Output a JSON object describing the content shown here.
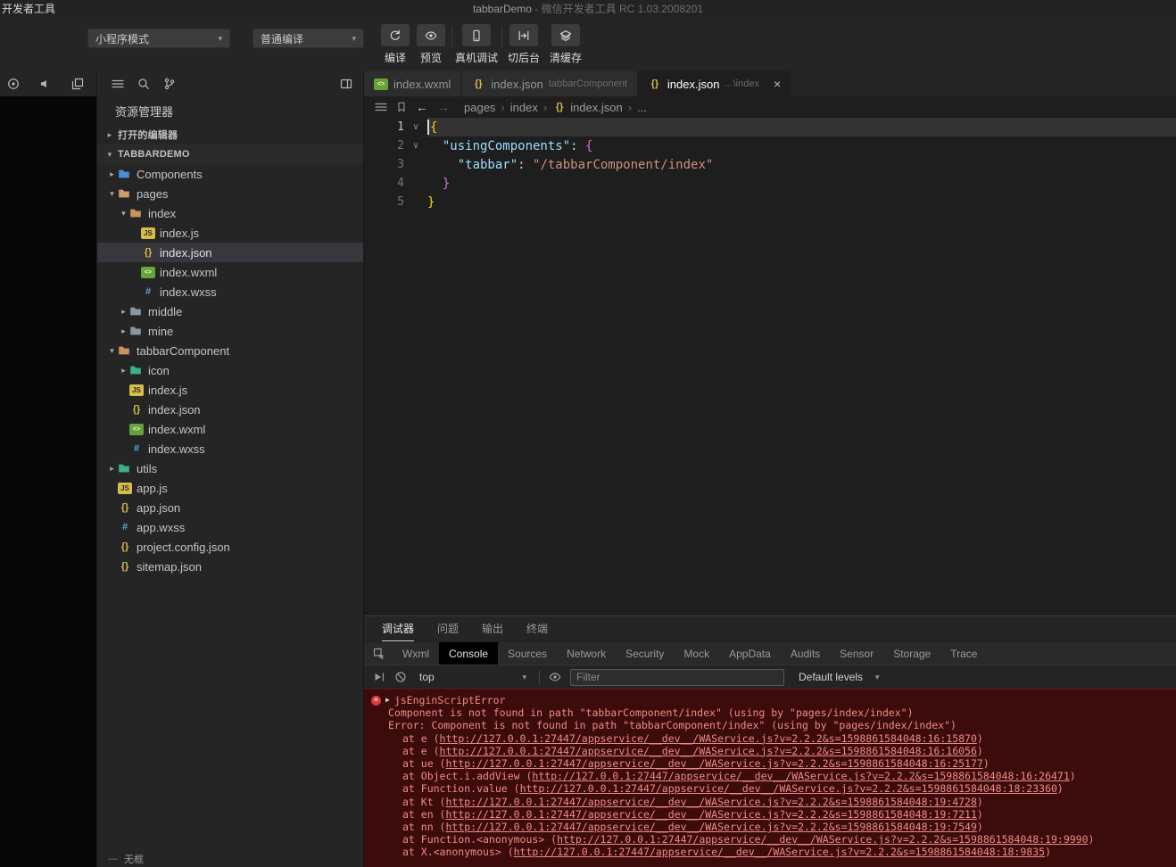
{
  "titlebar": {
    "window_title_left": "开发者工具",
    "project": "tabbarDemo",
    "suffix": " -  微信开发者工具 RC 1.03.2008201"
  },
  "toolbar": {
    "mode_select": "小程序模式",
    "compile_select": "普通编译",
    "actions": [
      {
        "key": "compile",
        "label": "编译",
        "icon": "compile-refresh-icon"
      },
      {
        "key": "preview",
        "label": "预览",
        "icon": "preview-eye-icon"
      },
      {
        "key": "device-debug",
        "label": "真机调试",
        "icon": "device-debug-icon"
      },
      {
        "key": "background",
        "label": "切后台",
        "icon": "background-switch-icon"
      },
      {
        "key": "clear-cache",
        "label": "清缓存",
        "icon": "clear-cache-icon"
      }
    ]
  },
  "explorer": {
    "header": "资源管理器",
    "open_editors_label": "打开的编辑器",
    "project_label": "TABBARDEMO",
    "status": "无框",
    "tree": [
      {
        "label": "Components",
        "depth": 1,
        "icon": "folder",
        "color": "#4a8fd4",
        "arrow": "collapsed"
      },
      {
        "label": "pages",
        "depth": 1,
        "icon": "folder",
        "color": "#d19a66",
        "arrow": "expanded"
      },
      {
        "label": "index",
        "depth": 2,
        "icon": "folder",
        "color": "#c8945a",
        "arrow": "expanded"
      },
      {
        "label": "index.js",
        "depth": 3,
        "icon": "js"
      },
      {
        "label": "index.json",
        "depth": 3,
        "icon": "json",
        "selected": true
      },
      {
        "label": "index.wxml",
        "depth": 3,
        "icon": "wxml"
      },
      {
        "label": "index.wxss",
        "depth": 3,
        "icon": "wxss"
      },
      {
        "label": "middle",
        "depth": 2,
        "icon": "folder",
        "color": "#8a97a0",
        "arrow": "collapsed"
      },
      {
        "label": "mine",
        "depth": 2,
        "icon": "folder",
        "color": "#8a97a0",
        "arrow": "collapsed"
      },
      {
        "label": "tabbarComponent",
        "depth": 1,
        "icon": "folder",
        "color": "#c8945a",
        "arrow": "expanded"
      },
      {
        "label": "icon",
        "depth": 2,
        "icon": "folder",
        "color": "#3dae8f",
        "arrow": "collapsed"
      },
      {
        "label": "index.js",
        "depth": 2,
        "icon": "js"
      },
      {
        "label": "index.json",
        "depth": 2,
        "icon": "json"
      },
      {
        "label": "index.wxml",
        "depth": 2,
        "icon": "wxml"
      },
      {
        "label": "index.wxss",
        "depth": 2,
        "icon": "wxss"
      },
      {
        "label": "utils",
        "depth": 1,
        "icon": "folder",
        "color": "#3dae8f",
        "arrow": "collapsed"
      },
      {
        "label": "app.js",
        "depth": 1,
        "icon": "js"
      },
      {
        "label": "app.json",
        "depth": 1,
        "icon": "json"
      },
      {
        "label": "app.wxss",
        "depth": 1,
        "icon": "wxss"
      },
      {
        "label": "project.config.json",
        "depth": 1,
        "icon": "json"
      },
      {
        "label": "sitemap.json",
        "depth": 1,
        "icon": "json"
      }
    ]
  },
  "editor": {
    "tabs": [
      {
        "name": "index.wxml",
        "icon": "wxml",
        "active": false
      },
      {
        "name": "index.json",
        "hint": "tabbarComponent",
        "icon": "json",
        "active": false
      },
      {
        "name": "index.json",
        "hint": "...\\index",
        "icon": "json",
        "active": true,
        "closable": true
      }
    ],
    "breadcrumb": [
      {
        "label": "pages"
      },
      {
        "label": "index"
      },
      {
        "label": "index.json",
        "icon": "json"
      },
      {
        "label": "..."
      }
    ],
    "code": {
      "lines": [
        {
          "n": 1,
          "fold": true,
          "current": true,
          "tokens": [
            [
              "{",
              "gold"
            ]
          ]
        },
        {
          "n": 2,
          "fold": true,
          "tokens": [
            [
              "  ",
              "plain"
            ],
            [
              "\"usingComponents\"",
              "key"
            ],
            [
              ": ",
              "plain"
            ],
            [
              "{",
              "purple"
            ]
          ]
        },
        {
          "n": 3,
          "tokens": [
            [
              "    ",
              "plain"
            ],
            [
              "\"tabbar\"",
              "key"
            ],
            [
              ": ",
              "plain"
            ],
            [
              "\"/tabbarComponent/index\"",
              "string"
            ]
          ]
        },
        {
          "n": 4,
          "tokens": [
            [
              "  ",
              "plain"
            ],
            [
              "}",
              "purple"
            ]
          ]
        },
        {
          "n": 5,
          "tokens": [
            [
              "}",
              "gold"
            ]
          ]
        }
      ]
    }
  },
  "panel": {
    "tabs": [
      "调试器",
      "问题",
      "输出",
      "终端"
    ],
    "active_tab": "调试器",
    "devtools_tabs": [
      "Wxml",
      "Console",
      "Sources",
      "Network",
      "Security",
      "Mock",
      "AppData",
      "Audits",
      "Sensor",
      "Storage",
      "Trace"
    ],
    "active_devtools_tab": "Console",
    "console_toolbar": {
      "context": "top",
      "filter_placeholder": "Filter",
      "levels": "Default levels"
    },
    "console": {
      "group_title": "jsEnginScriptError",
      "messages": [
        "Component is not found in path \"tabbarComponent/index\" (using by \"pages/index/index\")",
        "Error: Component is not found in path \"tabbarComponent/index\" (using by \"pages/index/index\")"
      ],
      "stack": [
        {
          "fn": "e",
          "url": "http://127.0.0.1:27447/appservice/__dev__/WAService.js?v=2.2.2&s=1598861584048:16:15870"
        },
        {
          "fn": "e",
          "url": "http://127.0.0.1:27447/appservice/__dev__/WAService.js?v=2.2.2&s=1598861584048:16:16056"
        },
        {
          "fn": "ue",
          "url": "http://127.0.0.1:27447/appservice/__dev__/WAService.js?v=2.2.2&s=1598861584048:16:25177"
        },
        {
          "fn": "Object.i.addView",
          "url": "http://127.0.0.1:27447/appservice/__dev__/WAService.js?v=2.2.2&s=1598861584048:16:26471"
        },
        {
          "fn": "Function.value",
          "url": "http://127.0.0.1:27447/appservice/__dev__/WAService.js?v=2.2.2&s=1598861584048:18:23360"
        },
        {
          "fn": "Kt",
          "url": "http://127.0.0.1:27447/appservice/__dev__/WAService.js?v=2.2.2&s=1598861584048:19:4728"
        },
        {
          "fn": "en",
          "url": "http://127.0.0.1:27447/appservice/__dev__/WAService.js?v=2.2.2&s=1598861584048:19:7211"
        },
        {
          "fn": "nn",
          "url": "http://127.0.0.1:27447/appservice/__dev__/WAService.js?v=2.2.2&s=1598861584048:19:7549"
        },
        {
          "fn": "Function.<anonymous>",
          "url": "http://127.0.0.1:27447/appservice/__dev__/WAService.js?v=2.2.2&s=1598861584048:19:9990"
        },
        {
          "fn": "X.<anonymous>",
          "url": "http://127.0.0.1:27447/appservice/__dev__/WAService.js?v=2.2.2&s=1598861584048:18:9835"
        }
      ]
    }
  },
  "colors": {
    "selection_bg": "#37373d",
    "error_bg": "#3c0b0b",
    "error_text": "#ee8c88",
    "syntax_key": "#9cdcfe",
    "syntax_string": "#ce9178",
    "bracket_gold": "#ffd700",
    "bracket_purple": "#da70d6"
  }
}
